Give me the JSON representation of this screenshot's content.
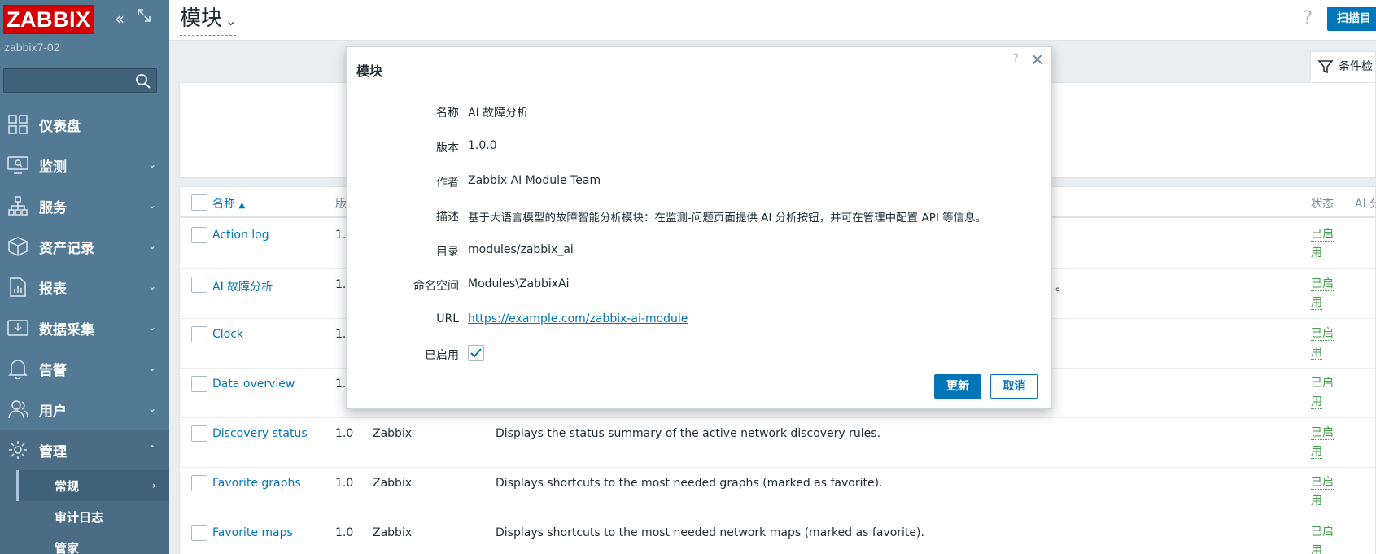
{
  "sidebar": {
    "logo": "ZABBIX",
    "hostname": "zabbix7-02",
    "search_placeholder": "",
    "items": [
      {
        "label": "仪表盘",
        "icon": "dashboard-icon"
      },
      {
        "label": "监测",
        "icon": "monitoring-icon"
      },
      {
        "label": "服务",
        "icon": "services-icon"
      },
      {
        "label": "资产记录",
        "icon": "inventory-icon"
      },
      {
        "label": "报表",
        "icon": "reports-icon"
      },
      {
        "label": "数据采集",
        "icon": "data-collection-icon"
      },
      {
        "label": "告警",
        "icon": "bell-icon"
      },
      {
        "label": "用户",
        "icon": "users-icon"
      },
      {
        "label": "管理",
        "icon": "gear-icon"
      }
    ],
    "submenu": [
      {
        "label": "常规"
      },
      {
        "label": "审计日志"
      },
      {
        "label": "管家"
      }
    ]
  },
  "header": {
    "title": "模块",
    "scan_label": "扫描目"
  },
  "filter": {
    "tab_label": "条件检"
  },
  "table": {
    "headers": {
      "name": "名称",
      "version": "版",
      "status": "状态",
      "ai": "AI 分"
    },
    "rows": [
      {
        "name": "Action log",
        "version": "1.",
        "author": "",
        "description": "",
        "status": "已启用"
      },
      {
        "name": "AI 故障分析",
        "version": "1.",
        "author": "",
        "description": "。",
        "status": "已启用"
      },
      {
        "name": "Clock",
        "version": "1.",
        "author": "",
        "description": "",
        "status": "已启用"
      },
      {
        "name": "Data overview",
        "version": "1.",
        "author": "",
        "description": "",
        "status": "已启用"
      },
      {
        "name": "Discovery status",
        "version": "1.0",
        "author": "Zabbix",
        "description": "Displays the status summary of the active network discovery rules.",
        "status": "已启用"
      },
      {
        "name": "Favorite graphs",
        "version": "1.0",
        "author": "Zabbix",
        "description": "Displays shortcuts to the most needed graphs (marked as favorite).",
        "status": "已启用"
      },
      {
        "name": "Favorite maps",
        "version": "1.0",
        "author": "Zabbix",
        "description": "Displays shortcuts to the most needed network maps (marked as favorite).",
        "status": "已启用"
      }
    ]
  },
  "modal": {
    "title": "模块",
    "help": "?",
    "fields": [
      {
        "label": "名称",
        "value": "AI 故障分析"
      },
      {
        "label": "版本",
        "value": "1.0.0"
      },
      {
        "label": "作者",
        "value": "Zabbix AI Module Team"
      },
      {
        "label": "描述",
        "value": "基于大语言模型的故障智能分析模块：在监测-问题页面提供 AI 分析按钮，并可在管理中配置 API 等信息。"
      },
      {
        "label": "目录",
        "value": "modules/zabbix_ai"
      },
      {
        "label": "命名空间",
        "value": "Modules\\ZabbixAi"
      },
      {
        "label": "URL",
        "value": "https://example.com/zabbix-ai-module"
      }
    ],
    "enabled_label": "已启用",
    "enabled": true,
    "update_label": "更新",
    "cancel_label": "取消"
  },
  "colors": {
    "sidebar_bg": "#527a94",
    "primary": "#0275b8",
    "enabled_green": "#429e47",
    "logo_red": "#d40000"
  }
}
